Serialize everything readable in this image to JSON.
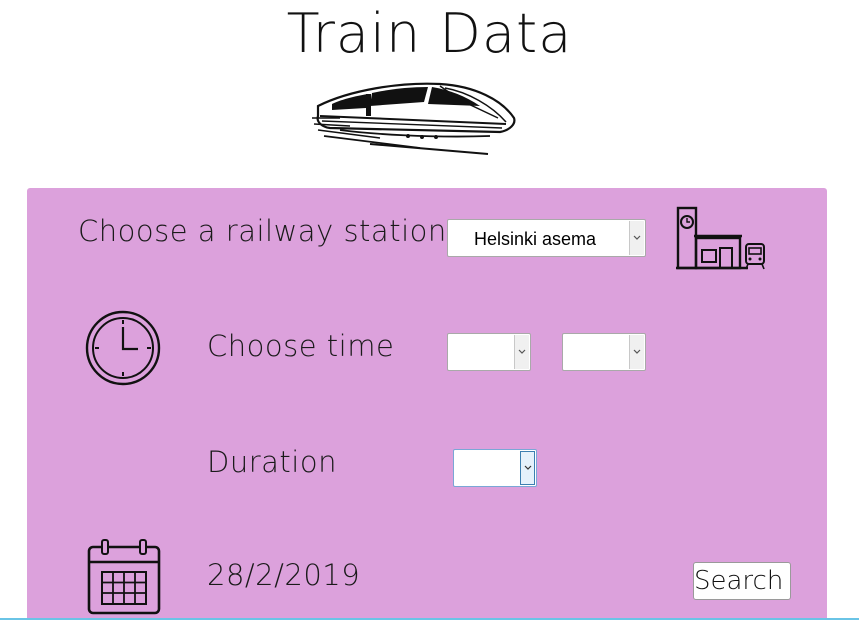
{
  "header": {
    "title": "Train Data",
    "logo_icon": "high-speed-train-icon"
  },
  "form": {
    "station": {
      "label": "Choose a railway station",
      "selected": "Helsinki asema",
      "icon": "railway-station-icon"
    },
    "time": {
      "label": "Choose time",
      "hour_selected": "",
      "minute_selected": "",
      "icon": "clock-icon"
    },
    "duration": {
      "label": "Duration",
      "selected": ""
    },
    "date": {
      "value": "28/2/2019",
      "icon": "calendar-icon"
    },
    "search_label": "Search"
  },
  "colors": {
    "panel_background": "#dca1dc",
    "text": "#1a1a1a",
    "bottom_accent": "#6ac4e6"
  }
}
